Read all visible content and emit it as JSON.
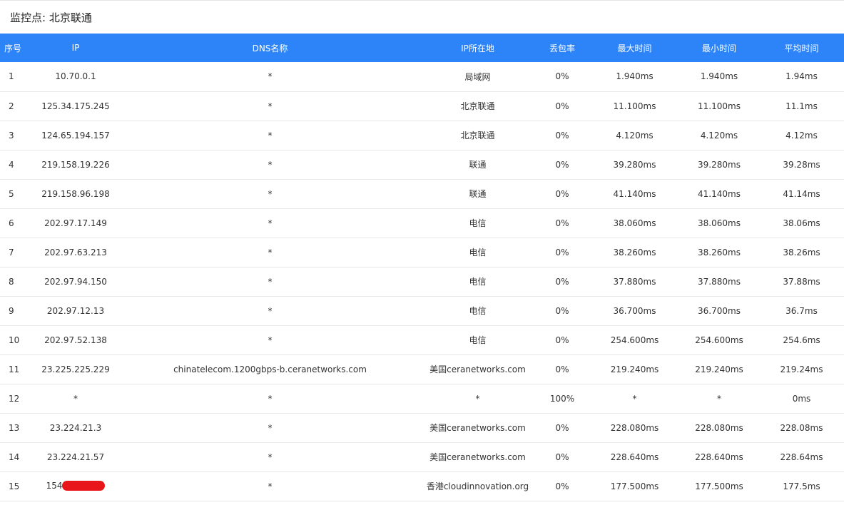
{
  "title": "监控点: 北京联通",
  "table": {
    "headers": [
      "序号",
      "IP",
      "DNS名称",
      "IP所在地",
      "丢包率",
      "最大时间",
      "最小时间",
      "平均时间"
    ],
    "rows": [
      [
        "1",
        "10.70.0.1",
        "*",
        "局域网",
        "0%",
        "1.940ms",
        "1.940ms",
        "1.94ms"
      ],
      [
        "2",
        "125.34.175.245",
        "*",
        "北京联通",
        "0%",
        "11.100ms",
        "11.100ms",
        "11.1ms"
      ],
      [
        "3",
        "124.65.194.157",
        "*",
        "北京联通",
        "0%",
        "4.120ms",
        "4.120ms",
        "4.12ms"
      ],
      [
        "4",
        "219.158.19.226",
        "*",
        "联通",
        "0%",
        "39.280ms",
        "39.280ms",
        "39.28ms"
      ],
      [
        "5",
        "219.158.96.198",
        "*",
        "联通",
        "0%",
        "41.140ms",
        "41.140ms",
        "41.14ms"
      ],
      [
        "6",
        "202.97.17.149",
        "*",
        "电信",
        "0%",
        "38.060ms",
        "38.060ms",
        "38.06ms"
      ],
      [
        "7",
        "202.97.63.213",
        "*",
        "电信",
        "0%",
        "38.260ms",
        "38.260ms",
        "38.26ms"
      ],
      [
        "8",
        "202.97.94.150",
        "*",
        "电信",
        "0%",
        "37.880ms",
        "37.880ms",
        "37.88ms"
      ],
      [
        "9",
        "202.97.12.13",
        "*",
        "电信",
        "0%",
        "36.700ms",
        "36.700ms",
        "36.7ms"
      ],
      [
        "10",
        "202.97.52.138",
        "*",
        "电信",
        "0%",
        "254.600ms",
        "254.600ms",
        "254.6ms"
      ],
      [
        "11",
        "23.225.225.229",
        "chinatelecom.1200gbps-b.ceranetworks.com",
        "美国ceranetworks.com",
        "0%",
        "219.240ms",
        "219.240ms",
        "219.24ms"
      ],
      [
        "12",
        "*",
        "*",
        "*",
        "100%",
        "*",
        "*",
        "0ms"
      ],
      [
        "13",
        "23.224.21.3",
        "*",
        "美国ceranetworks.com",
        "0%",
        "228.080ms",
        "228.080ms",
        "228.08ms"
      ],
      [
        "14",
        "23.224.21.57",
        "*",
        "美国ceranetworks.com",
        "0%",
        "228.640ms",
        "228.640ms",
        "228.64ms"
      ],
      [
        "15",
        "154.",
        "*",
        "香港cloudinnovation.org",
        "0%",
        "177.500ms",
        "177.500ms",
        "177.5ms"
      ]
    ]
  },
  "colors": {
    "header_bg": "#2d84f8",
    "header_text": "#ffffff",
    "redaction": "#e8151b"
  }
}
